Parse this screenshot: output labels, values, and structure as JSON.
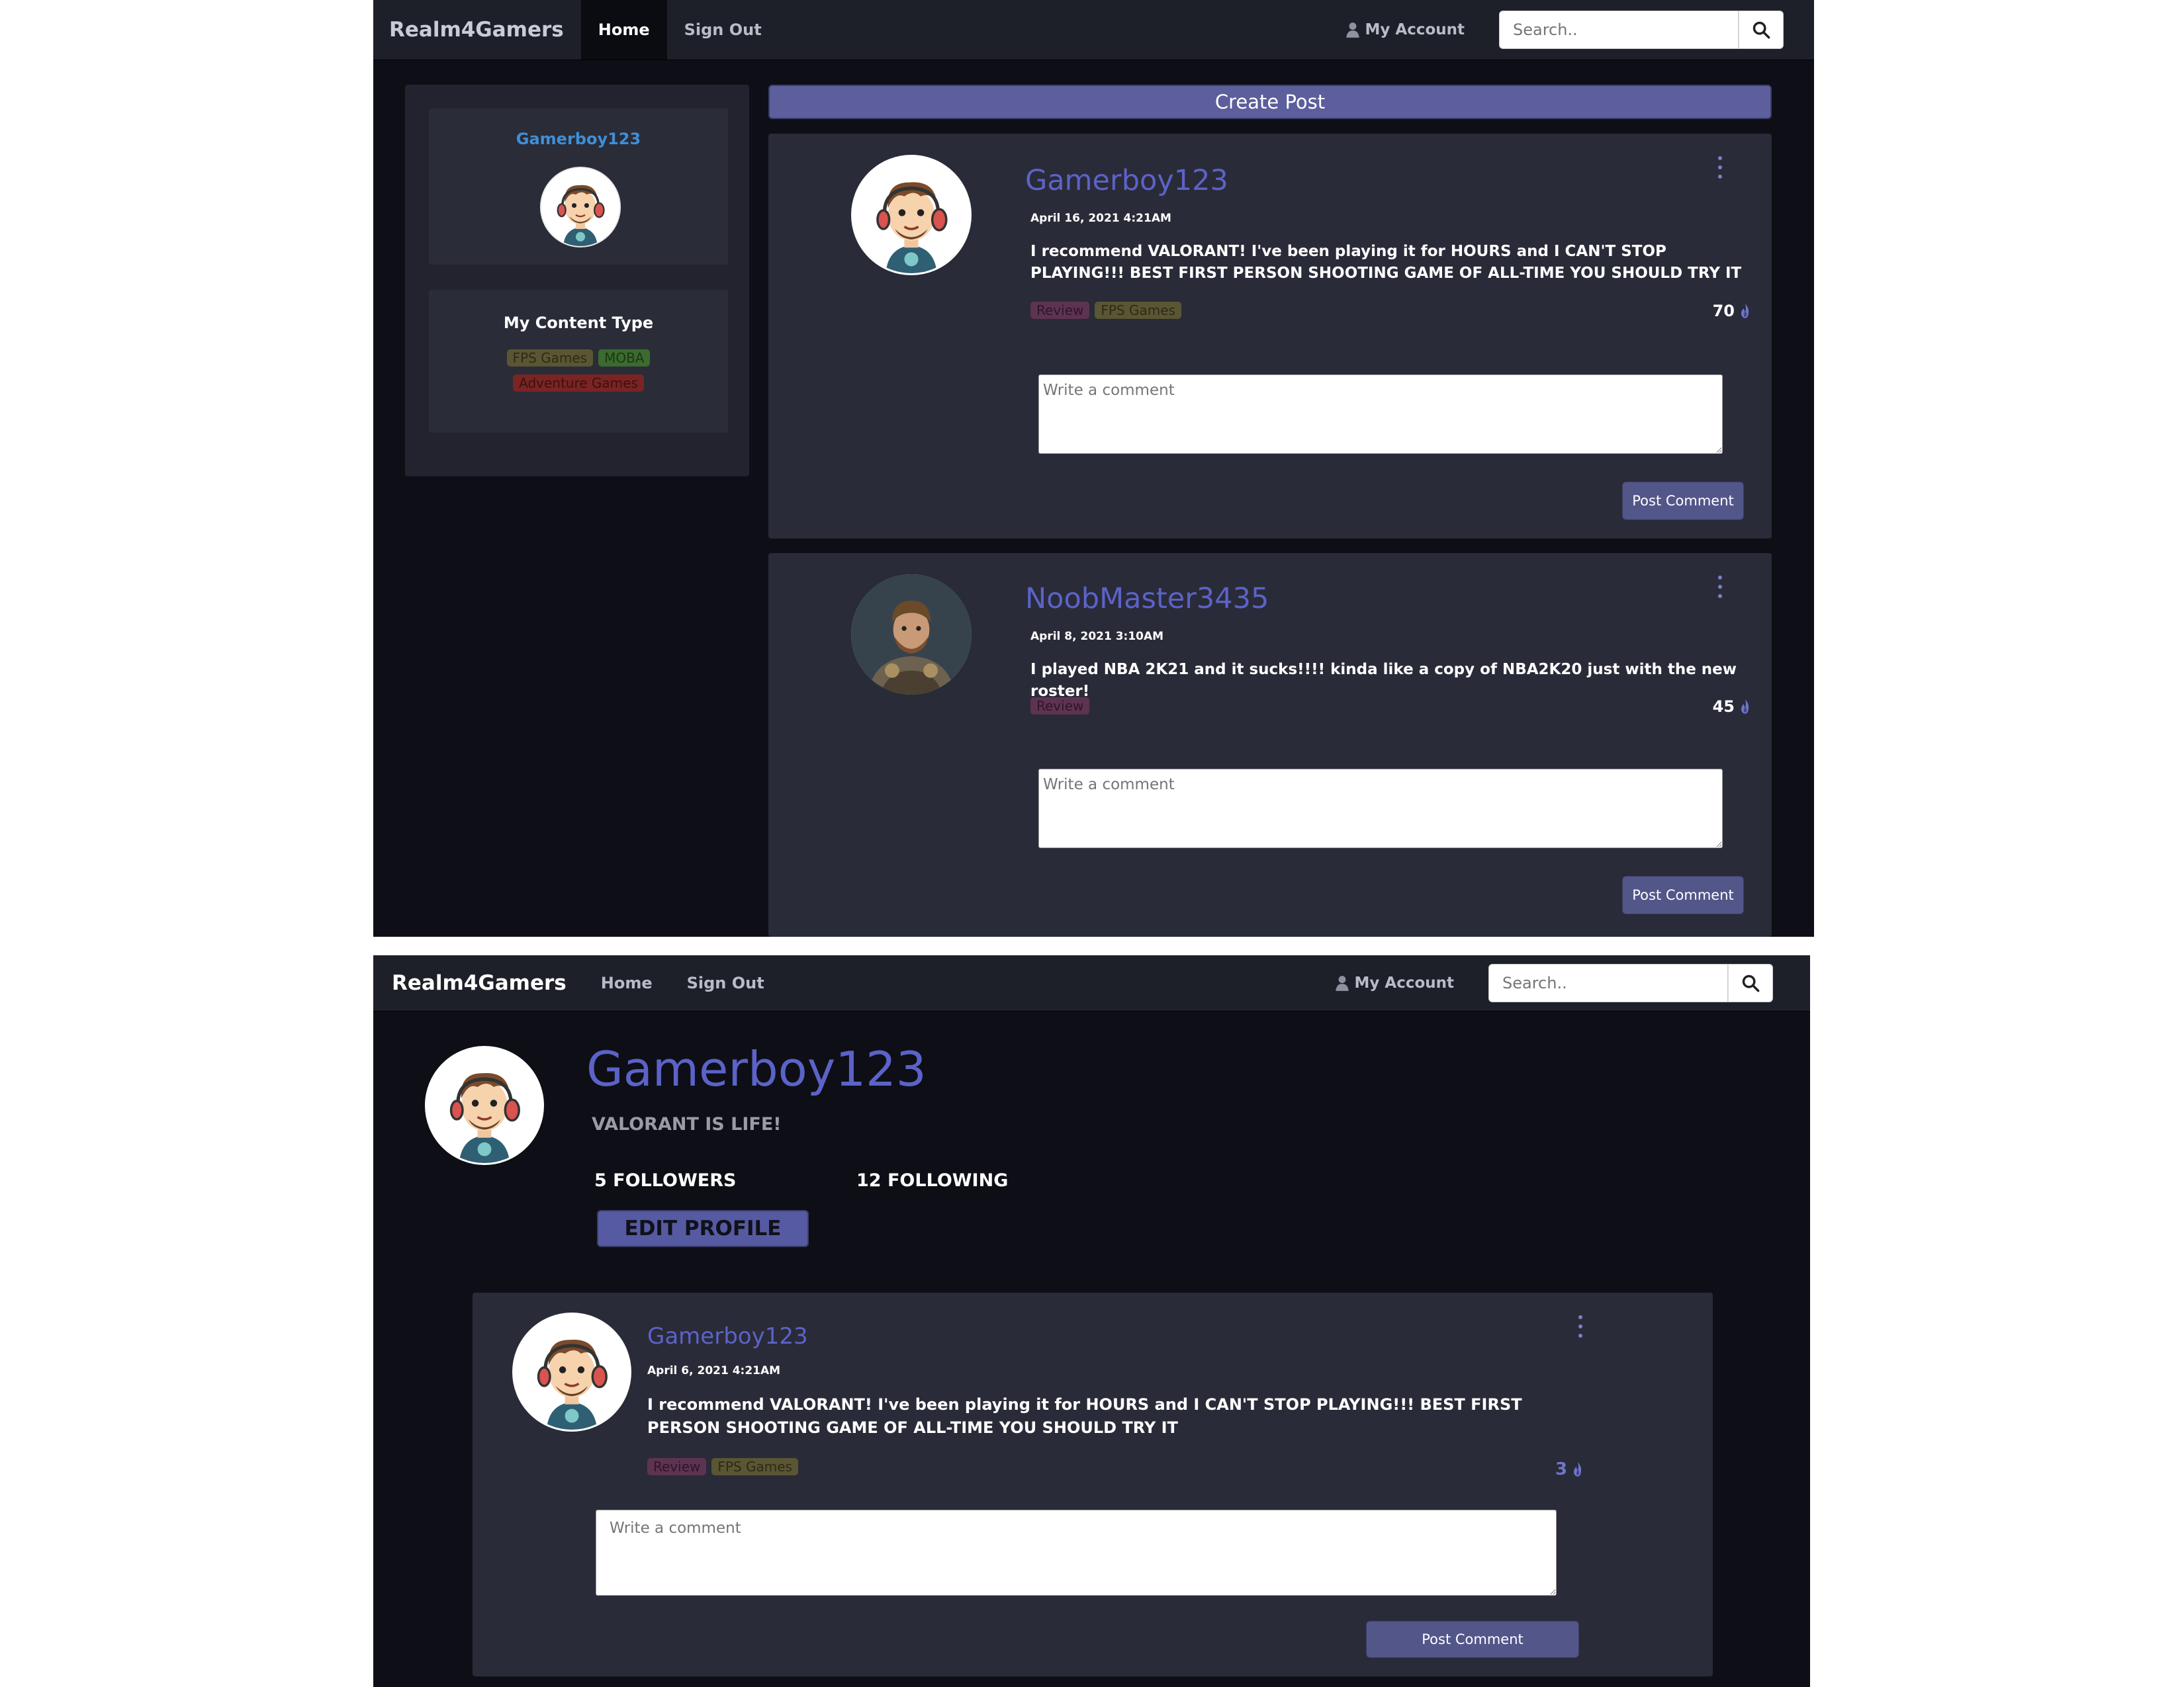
{
  "colors": {
    "page_bg": "#0e0f16",
    "navbar_bg": "#1e2029",
    "card_bg": "#2a2b38",
    "username_accent": "#5b63c8",
    "button_bg": "#535689"
  },
  "screen1": {
    "nav": {
      "brand": "Realm4Gamers",
      "home": "Home",
      "signout": "Sign Out",
      "account": "My Account",
      "search_placeholder": "Search.."
    },
    "sidebar": {
      "username": "Gamerboy123",
      "content_title": "My Content Type",
      "tags": [
        "FPS Games",
        "MOBA",
        "Adventure Games"
      ]
    },
    "create_post": "Create Post",
    "posts": [
      {
        "user": "Gamerboy123",
        "date": "April 16, 2021 4:21AM",
        "text": "I recommend VALORANT! I've been playing it for HOURS and I CAN'T STOP PLAYING!!! BEST FIRST PERSON SHOOTING GAME OF ALL-TIME YOU SHOULD TRY IT",
        "tags": [
          "Review",
          "FPS Games"
        ],
        "likes": "70",
        "comment_placeholder": "Write a comment",
        "button": "Post Comment"
      },
      {
        "user": "NoobMaster3435",
        "date": "April 8, 2021 3:10AM",
        "text": "I played NBA 2K21 and it sucks!!!! kinda like a copy of NBA2K20 just with the new roster!",
        "tags": [
          "Review"
        ],
        "likes": "45",
        "comment_placeholder": "Write a comment",
        "button": "Post Comment"
      }
    ]
  },
  "screen2": {
    "nav": {
      "brand": "Realm4Gamers",
      "home": "Home",
      "signout": "Sign Out",
      "account": "My Account",
      "search_placeholder": "Search.."
    },
    "profile": {
      "username": "Gamerboy123",
      "bio": "VALORANT IS LIFE!",
      "followers": "5 FOLLOWERS",
      "following": "12 FOLLOWING",
      "edit_button": "EDIT PROFILE"
    },
    "post": {
      "user": "Gamerboy123",
      "date": "April 6, 2021 4:21AM",
      "text": "I recommend VALORANT! I've been playing it for HOURS and I CAN'T STOP PLAYING!!! BEST FIRST PERSON SHOOTING GAME OF ALL-TIME YOU SHOULD TRY IT",
      "tags": [
        "Review",
        "FPS Games"
      ],
      "likes": "3",
      "comment_placeholder": "Write a comment",
      "button": "Post Comment"
    }
  }
}
